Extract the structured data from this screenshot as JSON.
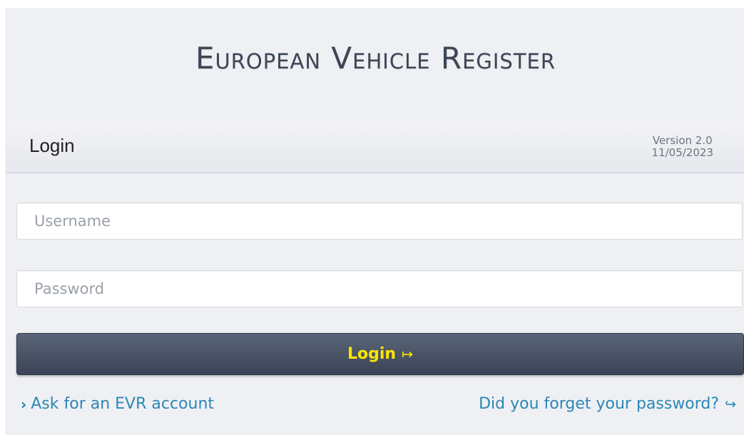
{
  "header": {
    "app_title": "European Vehicle Register"
  },
  "login_bar": {
    "heading": "Login",
    "version": "Version 2.0",
    "date": "11/05/2023"
  },
  "form": {
    "username_placeholder": "Username",
    "username_value": "",
    "password_placeholder": "Password",
    "password_value": "",
    "login_button_label": "Login",
    "login_button_icon": "right-arrow-icon"
  },
  "links": {
    "ask_account": "Ask for an EVR account",
    "ask_account_icon": "chevron-right-icon",
    "forgot_password": "Did you forget your password?",
    "forgot_password_icon": "return-arrow-icon"
  },
  "colors": {
    "background": "#eff0f3",
    "button_start": "#5a6578",
    "button_end": "#3b4456",
    "button_text": "#ffe600",
    "link": "#2b87b6",
    "title": "#3c4656"
  }
}
